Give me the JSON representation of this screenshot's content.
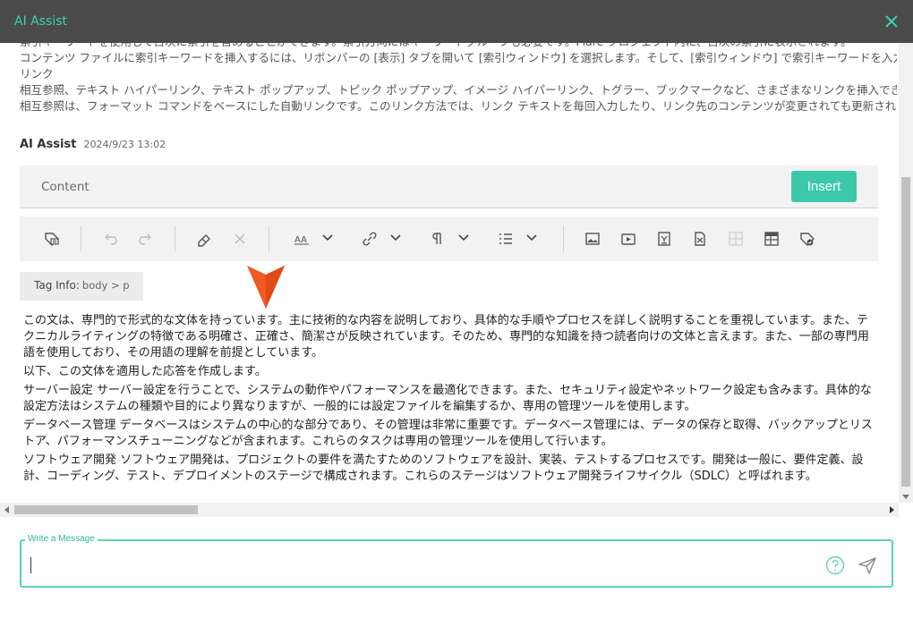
{
  "window": {
    "title": "AI Assist"
  },
  "previous_message": {
    "lines": [
      "索引キーワードを使用して目次に索引を含めることができます。索引方向にはキーワードグループも必要です。Flare プロジェクト内に、目次の索引に表示されます。",
      "コンテンツ ファイルに索引キーワードを挿入するには、リボンバーの [表示] タブを開いて [索引ウィンドウ] を選択します。そして、[索引ウィンドウ] で索引キーワードを入力します。",
      "リンク",
      "相互参照、テキスト ハイパーリンク、テキスト ポップアップ、トピック ポップアップ、イメージ ハイパーリンク、トグラー、ブックマークなど、さまざまなリンクを挿入できます。",
      "相互参照は、フォーマット コマンドをベースにした自動リンクです。このリンク方法では、リンク テキストを毎回入力したり、リンク先のコンテンツが変更されても更新されます。"
    ]
  },
  "message": {
    "author": "AI Assist",
    "timestamp": "2024/9/23 13:02"
  },
  "editor": {
    "tab_label": "Content",
    "insert_label": "Insert",
    "tag_info_label": "Tag Info:",
    "tag_path": "body  >  p"
  },
  "toolbar_icons": [
    "insert-tag-icon",
    "undo-icon",
    "redo-icon",
    "eraser-icon",
    "clear-icon",
    "font-size-icon",
    "link-icon",
    "paragraph-icon",
    "list-icon",
    "image-icon",
    "video-icon",
    "text-variable-icon",
    "snippet-icon",
    "table-icon",
    "table-style-icon",
    "condition-tag-icon"
  ],
  "content_paragraphs": [
    "この文は、専門的で形式的な文体を持っています。主に技術的な内容を説明しており、具体的な手順やプロセスを詳しく説明することを重視しています。また、テクニカルライティングの特徴である明確さ、正確さ、簡潔さが反映されています。そのため、専門的な知識を持つ読者向けの文体と言えます。また、一部の専門用語を使用しており、その用語の理解を前提としています。",
    "以下、この文体を適用した応答を作成します。",
    "サーバー設定 サーバー設定を行うことで、システムの動作やパフォーマンスを最適化できます。また、セキュリティ設定やネットワーク設定も含みます。具体的な設定方法はシステムの種類や目的により異なりますが、一般的には設定ファイルを編集するか、専用の管理ツールを使用します。",
    "データベース管理 データベースはシステムの中心的な部分であり、その管理は非常に重要です。データベース管理には、データの保存と取得、バックアップとリストア、パフォーマンスチューニングなどが含まれます。これらのタスクは専用の管理ツールを使用して行います。",
    "ソフトウェア開発 ソフトウェア開発は、プロジェクトの要件を満たすためのソフトウェアを設計、実装、テストするプロセスです。開発は一般に、要件定義、設計、コーディング、テスト、デプロイメントのステージで構成されます。これらのステージはソフトウェア開発ライフサイクル（SDLC）と呼ばれます。"
  ],
  "composer": {
    "label": "Write a Message",
    "value": ""
  },
  "colors": {
    "accent": "#3cc9a9",
    "titlebar": "#4a4a4a",
    "pointer": "#f05a22"
  }
}
